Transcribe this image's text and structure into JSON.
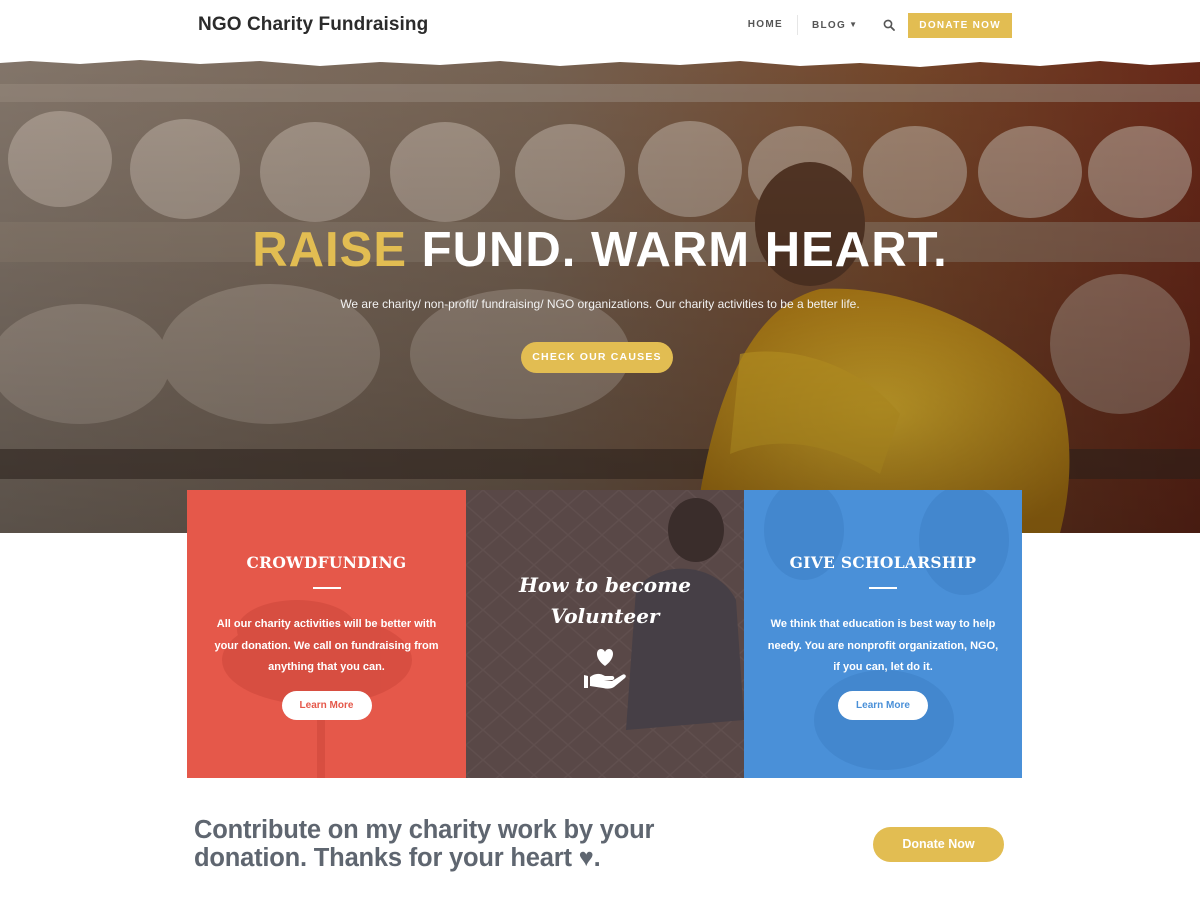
{
  "header": {
    "logo": "NGO Charity Fundraising",
    "nav": {
      "home": "HOME",
      "blog": "BLOG",
      "donate": "DONATE NOW"
    }
  },
  "hero": {
    "title_accent": "RAISE",
    "title_rest": "FUND. WARM HEART.",
    "subtitle": "We are charity/ non-profit/ fundraising/ NGO organizations. Our charity activities to be a better life.",
    "button": "CHECK OUR CAUSES"
  },
  "features": [
    {
      "title": "CROWDFUNDING",
      "text": "All our charity activities will be better with your donation. We call on fundraising from anything that you can.",
      "button": "Learn More"
    },
    {
      "title_line1": "How to become",
      "title_line2": "Volunteer",
      "icon": "hand-heart-icon"
    },
    {
      "title": "GIVE SCHOLARSHIP",
      "text": "We think that education is best way to help needy. You are nonprofit organization, NGO, if you can, let do it.",
      "button": "Learn More"
    }
  ],
  "cta": {
    "line1": "Contribute on my charity work by your",
    "line2": "donation. Thanks for your heart ♥.",
    "button": "Donate Now"
  },
  "colors": {
    "accent": "#e2bd52",
    "red": "#e5584a",
    "blue": "#4a90d8",
    "text": "#5f6670"
  }
}
